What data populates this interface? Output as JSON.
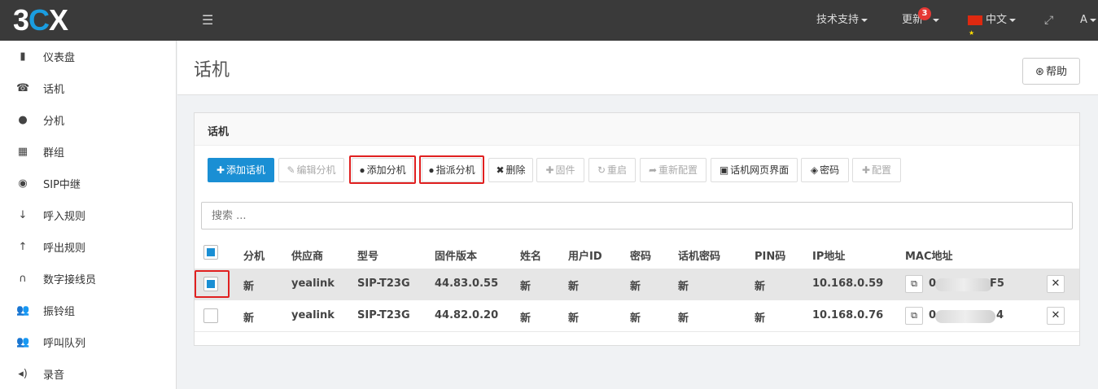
{
  "header": {
    "logo_3": "3",
    "logo_c": "C",
    "logo_x": "X",
    "menu_icon": "hamburger-menu-icon",
    "support_label": "技术支持",
    "update_label": "更新",
    "update_badge": "3",
    "language_label": "中文",
    "user_label": "A"
  },
  "sidebar": {
    "items": [
      {
        "label": "仪表盘",
        "icon": "bar-chart-icon"
      },
      {
        "label": "话机",
        "icon": "phone-icon"
      },
      {
        "label": "分机",
        "icon": "user-icon"
      },
      {
        "label": "群组",
        "icon": "grid-icon"
      },
      {
        "label": "SIP中继",
        "icon": "globe-icon"
      },
      {
        "label": "呼入规则",
        "icon": "arrow-down-icon"
      },
      {
        "label": "呼出规则",
        "icon": "arrow-up-icon"
      },
      {
        "label": "数字接线员",
        "icon": "headset-icon"
      },
      {
        "label": "振铃组",
        "icon": "users-icon"
      },
      {
        "label": "呼叫队列",
        "icon": "users-icon"
      },
      {
        "label": "录音",
        "icon": "volume-icon"
      }
    ]
  },
  "page": {
    "title": "话机",
    "help_label": "帮助"
  },
  "panel": {
    "title": "话机",
    "toolbar": {
      "add_phone": "添加话机",
      "edit_ext": "编辑分机",
      "add_ext": "添加分机",
      "assign_ext": "指派分机",
      "delete": "删除",
      "firmware": "固件",
      "restart": "重启",
      "reprovision": "重新配置",
      "phone_web_ui": "话机网页界面",
      "password": "密码",
      "config": "配置"
    },
    "search_placeholder": "搜索 ...",
    "columns": [
      "分机",
      "供应商",
      "型号",
      "固件版本",
      "姓名",
      "用户ID",
      "密码",
      "话机密码",
      "PIN码",
      "IP地址",
      "MAC地址"
    ],
    "rows": [
      {
        "selected": true,
        "ext": "新",
        "vendor": "yealink",
        "model": "SIP-T23G",
        "firmware": "44.83.0.55",
        "name": "新",
        "user_id": "新",
        "password": "新",
        "phone_password": "新",
        "pin": "新",
        "ip": "10.168.0.59",
        "mac_start": "0",
        "mac_end": "F5"
      },
      {
        "selected": false,
        "ext": "新",
        "vendor": "yealink",
        "model": "SIP-T23G",
        "firmware": "44.82.0.20",
        "name": "新",
        "user_id": "新",
        "password": "新",
        "phone_password": "新",
        "pin": "新",
        "ip": "10.168.0.76",
        "mac_start": "0",
        "mac_end": "4"
      }
    ]
  },
  "colors": {
    "topbar": "#3a3a3a",
    "accent": "#1a8fd4",
    "highlight": "#e02020",
    "selected_row": "#e6e6e6"
  }
}
